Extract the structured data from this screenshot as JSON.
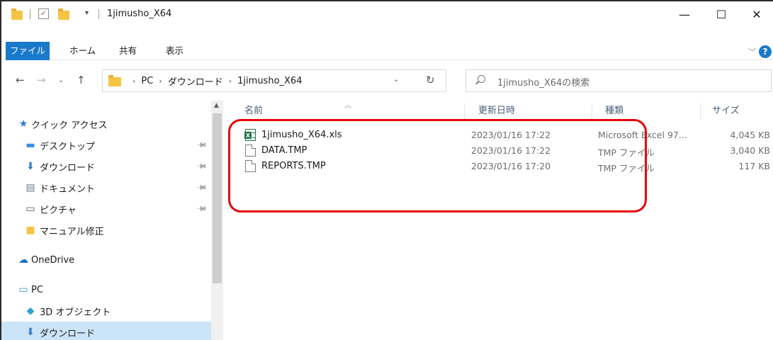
{
  "window": {
    "title": "1jimusho_X64",
    "minimize": "—",
    "maximize": "☐",
    "close": "✕"
  },
  "ribbon": {
    "tabs": [
      {
        "label": "ファイル"
      },
      {
        "label": "ホーム"
      },
      {
        "label": "共有"
      },
      {
        "label": "表示"
      }
    ],
    "help": "?"
  },
  "address": {
    "crumbs": [
      "PC",
      "ダウンロード",
      "1jimusho_X64"
    ],
    "search_placeholder": "1jimusho_X64の検索"
  },
  "navpane": {
    "items": [
      {
        "label": "クイック アクセス",
        "icon": "star-icon",
        "pinned": false
      },
      {
        "label": "デスクトップ",
        "icon": "desktop-icon",
        "pinned": true
      },
      {
        "label": "ダウンロード",
        "icon": "download-icon",
        "pinned": true
      },
      {
        "label": "ドキュメント",
        "icon": "document-icon",
        "pinned": true
      },
      {
        "label": "ピクチャ",
        "icon": "pictures-icon",
        "pinned": true
      },
      {
        "label": "マニュアル修正",
        "icon": "folder-icon",
        "pinned": false
      },
      {
        "label": "OneDrive",
        "icon": "cloud-icon",
        "pinned": false
      },
      {
        "label": "PC",
        "icon": "pc-icon",
        "pinned": false
      },
      {
        "label": "3D オブジェクト",
        "icon": "3d-objects-icon",
        "pinned": false
      },
      {
        "label": "ダウンロード",
        "icon": "download-icon",
        "pinned": false,
        "selected": true
      }
    ]
  },
  "filelist": {
    "columns": {
      "name": "名前",
      "date": "更新日時",
      "type": "種類",
      "size": "サイズ"
    },
    "files": [
      {
        "name": "1jimusho_X64.xls",
        "date": "2023/01/16 17:22",
        "type": "Microsoft Excel 97...",
        "size": "4,045 KB",
        "icon": "excel-file-icon"
      },
      {
        "name": "DATA.TMP",
        "date": "2023/01/16 17:22",
        "type": "TMP ファイル",
        "size": "3,040 KB",
        "icon": "file-icon"
      },
      {
        "name": "REPORTS.TMP",
        "date": "2023/01/16 17:20",
        "type": "TMP ファイル",
        "size": "117 KB",
        "icon": "file-icon"
      }
    ]
  },
  "colors": {
    "accent": "#1979ca",
    "highlight": "#e8000b",
    "selection": "#cce4f7"
  }
}
